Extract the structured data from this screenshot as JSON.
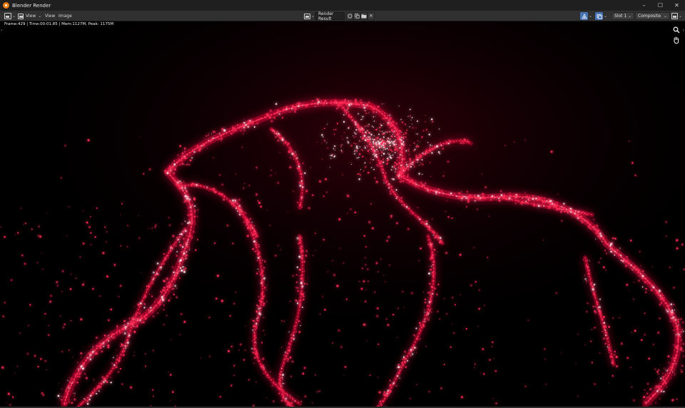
{
  "window": {
    "title": "Blender Render",
    "controls": {
      "minimize": "–",
      "maximize": "☐",
      "close": "✕"
    }
  },
  "header": {
    "menus": [
      {
        "label": "View"
      },
      {
        "label": "View"
      },
      {
        "label": "Image"
      }
    ],
    "image_datablock": "Render Result",
    "slot": "Slot 1",
    "layer": "Composite",
    "close_glyph": "✕",
    "chevron": "⌄"
  },
  "viewport": {
    "stats": "Frame:429 | Time:00:01.85 | Mem:1127M, Peak: 1175M",
    "collapse_arrow_left": "›",
    "collapse_arrow_right": "‹"
  },
  "colors": {
    "particle_core": "#ffd6e0",
    "particle_mid": "#ff2a55",
    "particle_glow": "#b8002a",
    "accent_blue": "#4772b3",
    "blender_orange": "#e87d0d"
  },
  "icons": {
    "app": "blender-logo-icon",
    "editor_type": "image-editor-icon",
    "zoom": "magnifier-icon",
    "pan": "hand-icon"
  }
}
